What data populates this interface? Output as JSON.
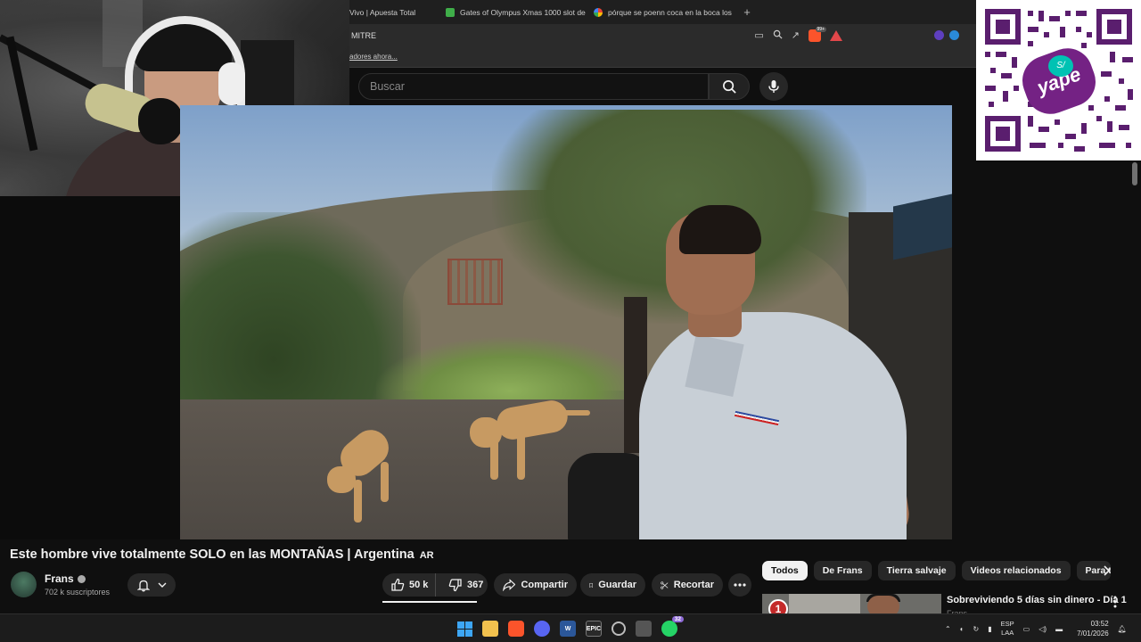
{
  "browser": {
    "tabs": [
      {
        "title": "Vivo | Apuesta Total",
        "color": "#1f1f1f"
      },
      {
        "title": "Gates of Olympus Xmas 1000 slot de",
        "color": "#3fae49"
      },
      {
        "title": "pórque se poenn coca en la boca los",
        "color": "#e8e8e8"
      }
    ],
    "new_tab": "+",
    "tab_close": "×",
    "address": "MITRE",
    "brave_badge": "99+",
    "bookmarks_text": "adores ahora..."
  },
  "youtube": {
    "search_placeholder": "Buscar",
    "video_title": "Este hombre vive totalmente SOLO en las MONTAÑAS | Argentina",
    "title_badge": "AR",
    "channel": {
      "name": "Frans",
      "subscribers": "702 k suscriptores"
    },
    "actions": {
      "likes": "50 k",
      "dislikes": "367",
      "share": "Compartir",
      "save": "Guardar",
      "clip": "Recortar"
    },
    "chips": [
      "Todos",
      "De Frans",
      "Tierra salvaje",
      "Videos relacionados",
      "Para ti"
    ],
    "related": {
      "title": "Sobreviviendo 5 días sin dinero - Día 1",
      "channel": "Frans",
      "episode_number": "1"
    }
  },
  "overlay": {
    "qr_brand": "yape",
    "qr_badge": "S/"
  },
  "taskbar": {
    "whatsapp_badge": "32",
    "epic_label": "EPIC",
    "office_label": "W",
    "lang_line1": "ESP",
    "lang_line2": "LAA",
    "time": "03:52",
    "date": "7/01/2026"
  },
  "colors": {
    "background": "#0f0f0f",
    "chip_active": "#f1f1f1",
    "pill": "#272727",
    "yape_purple": "#742284",
    "yape_teal": "#00c2b3"
  }
}
